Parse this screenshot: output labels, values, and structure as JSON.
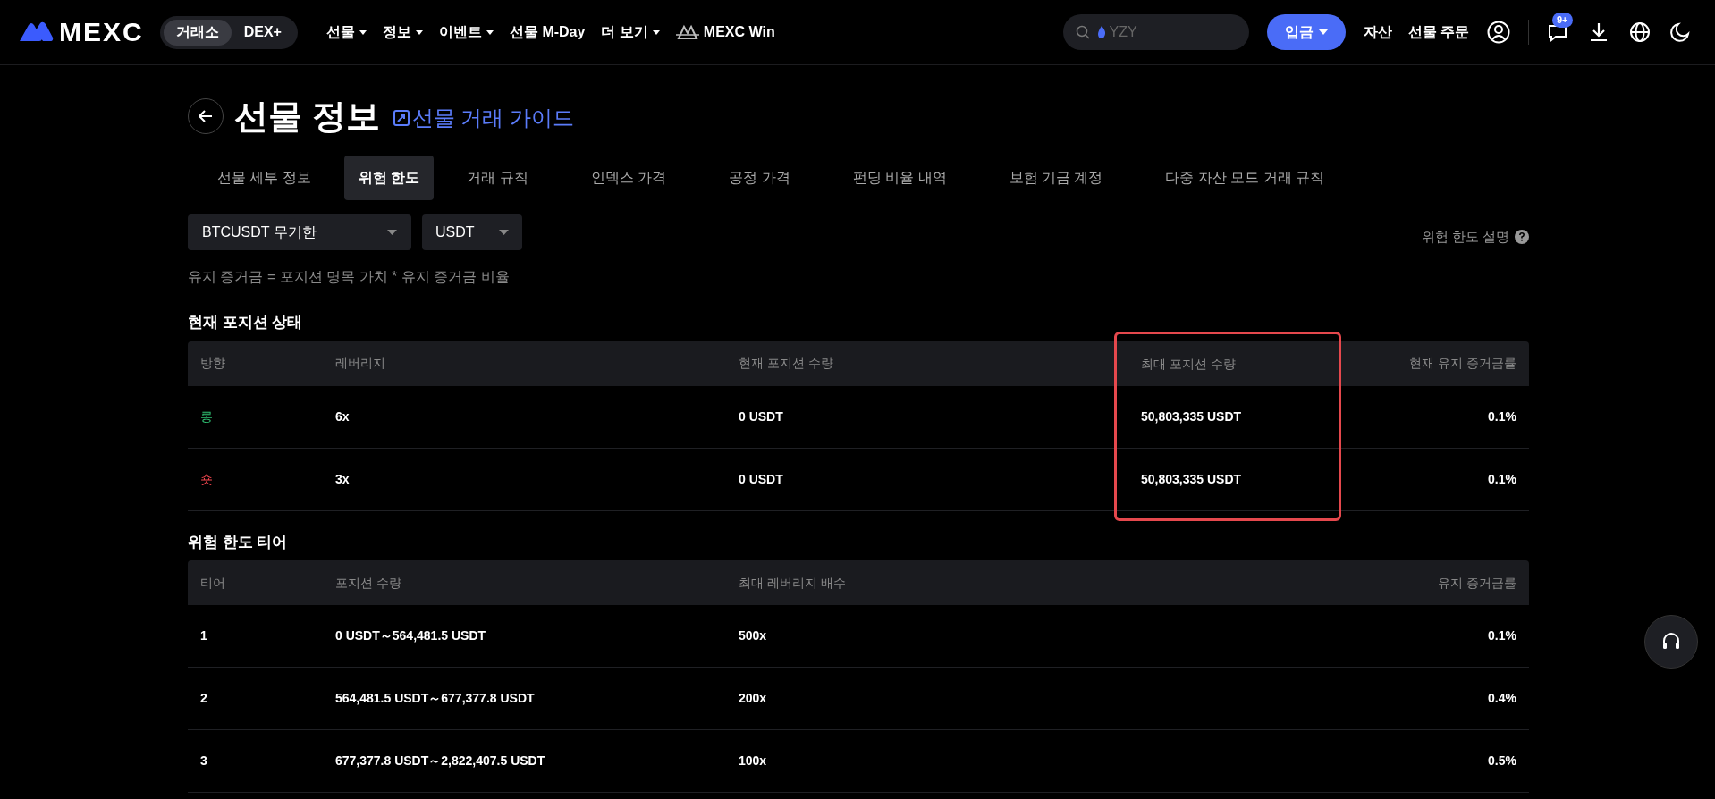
{
  "header": {
    "logo": "MEXC",
    "mode_switch": [
      {
        "label": "거래소",
        "selected": true
      },
      {
        "label": "DEX+",
        "selected": false
      }
    ],
    "nav": [
      {
        "label": "선물",
        "dropdown": true,
        "kind": "text"
      },
      {
        "label": "정보",
        "dropdown": true,
        "kind": "text"
      },
      {
        "label": "이벤트",
        "dropdown": true,
        "kind": "text"
      },
      {
        "label": "선물 M-Day",
        "dropdown": false,
        "kind": "text"
      },
      {
        "label": "더 보기",
        "dropdown": true,
        "kind": "text"
      },
      {
        "label": "MEXC Win",
        "dropdown": false,
        "kind": "win"
      }
    ],
    "search": {
      "placeholder": "YZY"
    },
    "deposit_button": "입금",
    "links": [
      "자산",
      "선물 주문"
    ],
    "notification_badge": "9+"
  },
  "page": {
    "title": "선물 정보",
    "guide_link": "선물 거래 가이드",
    "tabs": [
      {
        "label": "선물 세부 정보",
        "selected": false
      },
      {
        "label": "위험 한도",
        "selected": true
      },
      {
        "label": "거래 규칙",
        "selected": false
      },
      {
        "label": "인덱스 가격",
        "selected": false
      },
      {
        "label": "공정 가격",
        "selected": false
      },
      {
        "label": "펀딩 비율 내역",
        "selected": false
      },
      {
        "label": "보험 기금 계정",
        "selected": false
      },
      {
        "label": "다중 자산 모드 거래 규칙",
        "selected": false
      }
    ],
    "contract_select": "BTCUSDT 무기한",
    "currency_select": "USDT",
    "help_link": "위험 한도 설명",
    "formula": "유지 증거금 = 포지션 명목 가치 * 유지 증거금 비율"
  },
  "position_status": {
    "title": "현재 포지션 상태",
    "columns": [
      {
        "label": "방향",
        "highlighted": false
      },
      {
        "label": "레버리지",
        "highlighted": false
      },
      {
        "label": "현재 포지션 수량",
        "highlighted": false
      },
      {
        "label": "최대 포지션 수량",
        "highlighted": true
      },
      {
        "label": "현재 유지 증거금률",
        "highlighted": false
      }
    ],
    "rows": [
      {
        "color": "#2fbf71",
        "cells": [
          "롱",
          "6x",
          "0 USDT",
          "50,803,335 USDT",
          "0.1%"
        ]
      },
      {
        "color": "#f0454d",
        "cells": [
          "숏",
          "3x",
          "0 USDT",
          "50,803,335 USDT",
          "0.1%"
        ]
      }
    ]
  },
  "risk_tiers": {
    "title": "위험 한도 티어",
    "columns": [
      "티어",
      "포지션 수량",
      "최대 레버리지 배수",
      "유지 증거금률"
    ],
    "rows": [
      [
        "1",
        "0 USDT～564,481.5 USDT",
        "500x",
        "0.1%"
      ],
      [
        "2",
        "564,481.5 USDT～677,377.8 USDT",
        "200x",
        "0.4%"
      ],
      [
        "3",
        "677,377.8 USDT～2,822,407.5 USDT",
        "100x",
        "0.5%"
      ]
    ]
  }
}
